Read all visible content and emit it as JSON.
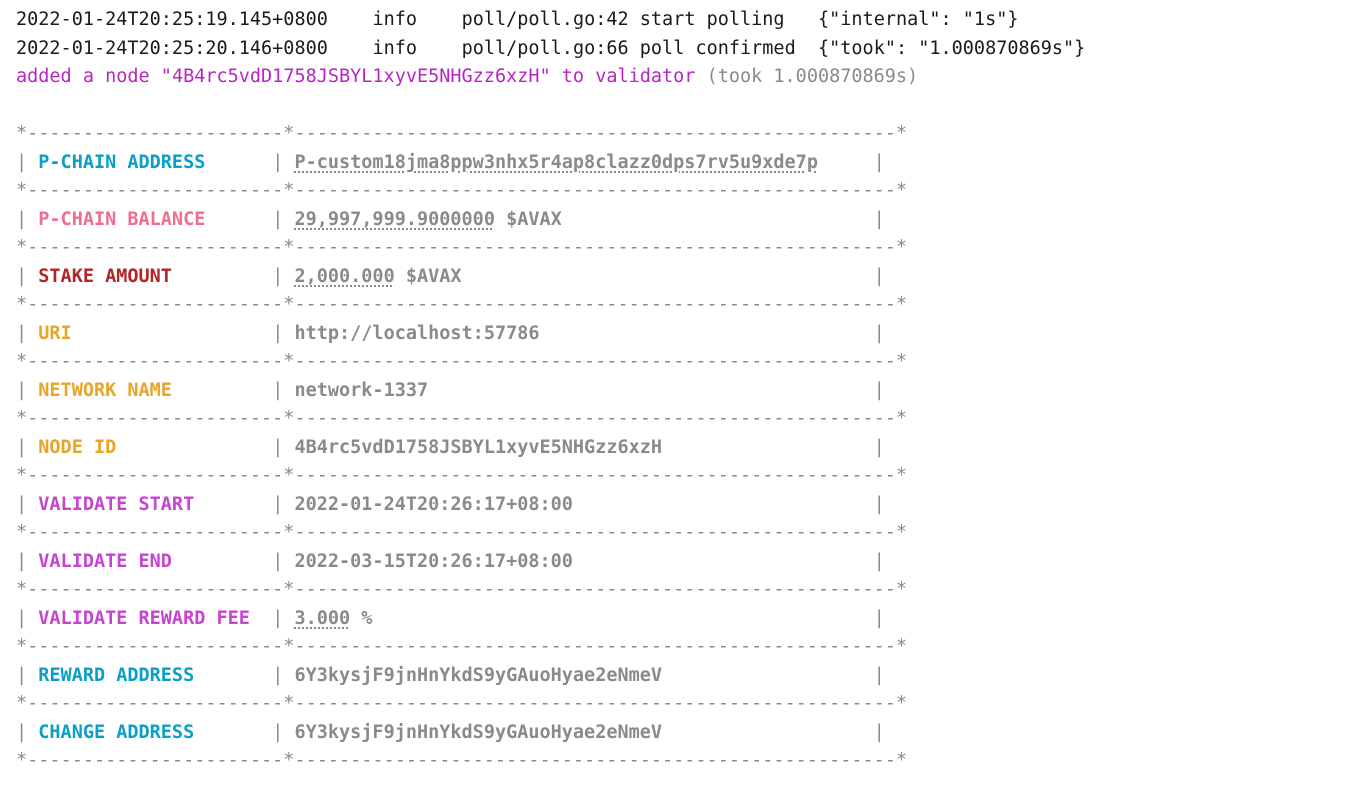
{
  "log_lines": [
    {
      "ts": "2022-01-24T20:25:19.145+0800",
      "level": "info",
      "src": "poll/poll.go:42",
      "msg": "start polling",
      "kv": "{\"internal\": \"1s\"}"
    },
    {
      "ts": "2022-01-24T20:25:20.146+0800",
      "level": "info",
      "src": "poll/poll.go:66",
      "msg": "poll confirmed",
      "kv": "{\"took\": \"1.000870869s\"}"
    }
  ],
  "added_line": {
    "prefix": "added a node \"",
    "node_id": "4B4rc5vdD1758JSBYL1xyvE5NHGzz6xzH",
    "middle": "\" to validator ",
    "suffix": "(took 1.000870869s)"
  },
  "border": {
    "full": "*-----------------------*------------------------------------------------------*"
  },
  "rows": [
    {
      "label": "P-CHAIN ADDRESS",
      "label_class": "fg-cyan",
      "value": "P-custom18jma8ppw3nhx5r4ap8clazz0dps7rv5u9xde7p",
      "value_ul": true
    },
    {
      "label": "P-CHAIN BALANCE",
      "label_class": "fg-pink",
      "value": "29,997,999.9000000",
      "value_ul": true,
      "suffix": " $AVAX"
    },
    {
      "label": "STAKE AMOUNT",
      "label_class": "fg-darkred",
      "value": "2,000.000",
      "value_ul": true,
      "suffix": " $AVAX"
    },
    {
      "label": "URI",
      "label_class": "fg-yellow",
      "value": "http://localhost:57786"
    },
    {
      "label": "NETWORK NAME",
      "label_class": "fg-yellow",
      "value": "network-1337"
    },
    {
      "label": "NODE ID",
      "label_class": "fg-yellow",
      "value": "4B4rc5vdD1758JSBYL1xyvE5NHGzz6xzH"
    },
    {
      "label": "VALIDATE START",
      "label_class": "fg-magenta",
      "value": "2022-01-24T20:26:17+08:00"
    },
    {
      "label": "VALIDATE END",
      "label_class": "fg-magenta",
      "value": "2022-03-15T20:26:17+08:00"
    },
    {
      "label": "VALIDATE REWARD FEE",
      "label_class": "fg-magenta",
      "value": "3.000",
      "value_ul": true,
      "suffix": " %"
    },
    {
      "label": "REWARD ADDRESS",
      "label_class": "fg-cyan",
      "value": "6Y3kysjF9jnHnYkdS9yGAuoHyae2eNmeV"
    },
    {
      "label": "CHANGE ADDRESS",
      "label_class": "fg-cyan",
      "value": "6Y3kysjF9jnHnYkdS9yGAuoHyae2eNmeV"
    }
  ],
  "layout": {
    "label_col_inner_width": 21,
    "value_col_inner_width": 52
  }
}
